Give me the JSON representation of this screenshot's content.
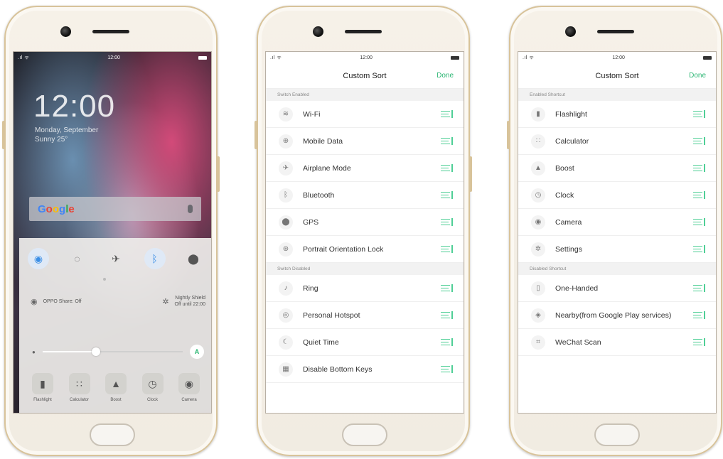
{
  "status": {
    "time": "12:00"
  },
  "lock_screen": {
    "clock": "12:00",
    "date_line": "Monday, September",
    "weather_line": "Sunny 25°",
    "search": {
      "logo": [
        "G",
        "o",
        "o",
        "g",
        "l",
        "e"
      ]
    },
    "quick_settings": {
      "toggles": [
        {
          "icon": "wifi-icon",
          "glyph": "◉",
          "on": true
        },
        {
          "icon": "mobile-data-icon",
          "glyph": "◌",
          "on": false
        },
        {
          "icon": "airplane-icon",
          "glyph": "✈",
          "on": false
        },
        {
          "icon": "bluetooth-icon",
          "glyph": "ᛒ",
          "on": true
        },
        {
          "icon": "location-icon",
          "glyph": "⬤",
          "on": false
        }
      ],
      "oppo_share": "OPPO Share: Off",
      "night_shield_1": "Nightly Shield",
      "night_shield_2": "Off until 22:00",
      "brightness": 0.38,
      "brightness_auto": "A",
      "shortcuts": [
        {
          "label": "Flashlight",
          "glyph": "▮",
          "icon": "flashlight-icon"
        },
        {
          "label": "Calculator",
          "glyph": "∷",
          "icon": "calculator-icon"
        },
        {
          "label": "Boost",
          "glyph": "▲",
          "icon": "boost-icon"
        },
        {
          "label": "Clock",
          "glyph": "◷",
          "icon": "clock-icon"
        },
        {
          "label": "Camera",
          "glyph": "◉",
          "icon": "camera-icon"
        }
      ]
    }
  },
  "sort_switch": {
    "title": "Custom Sort",
    "done": "Done",
    "enabled_header": "Switch Enabled",
    "enabled": [
      {
        "label": "Wi-Fi",
        "glyph": "≋",
        "icon": "wifi-icon"
      },
      {
        "label": "Mobile Data",
        "glyph": "⊕",
        "icon": "mobile-data-icon"
      },
      {
        "label": "Airplane Mode",
        "glyph": "✈",
        "icon": "airplane-icon"
      },
      {
        "label": "Bluetooth",
        "glyph": "ᛒ",
        "icon": "bluetooth-icon"
      },
      {
        "label": "GPS",
        "glyph": "⬤",
        "icon": "gps-icon"
      },
      {
        "label": "Portrait Orientation Lock",
        "glyph": "⊛",
        "icon": "orientation-lock-icon"
      }
    ],
    "disabled_header": "Switch Disabled",
    "disabled": [
      {
        "label": "Ring",
        "glyph": "♪",
        "icon": "ring-icon"
      },
      {
        "label": "Personal Hotspot",
        "glyph": "◎",
        "icon": "hotspot-icon"
      },
      {
        "label": "Quiet Time",
        "glyph": "☾",
        "icon": "moon-icon"
      },
      {
        "label": "Disable Bottom Keys",
        "glyph": "▦",
        "icon": "keys-icon"
      }
    ]
  },
  "sort_shortcut": {
    "title": "Custom Sort",
    "done": "Done",
    "enabled_header": "Enabled Shortcut",
    "enabled": [
      {
        "label": "Flashlight",
        "glyph": "▮",
        "icon": "flashlight-icon"
      },
      {
        "label": "Calculator",
        "glyph": "∷",
        "icon": "calculator-icon"
      },
      {
        "label": "Boost",
        "glyph": "▲",
        "icon": "boost-icon"
      },
      {
        "label": "Clock",
        "glyph": "◷",
        "icon": "clock-icon"
      },
      {
        "label": "Camera",
        "glyph": "◉",
        "icon": "camera-icon"
      },
      {
        "label": "Settings",
        "glyph": "✲",
        "icon": "settings-icon"
      }
    ],
    "disabled_header": "Disabled Shortcut",
    "disabled": [
      {
        "label": "One-Handed",
        "glyph": "▯",
        "icon": "one-handed-icon"
      },
      {
        "label": "Nearby(from Google Play services)",
        "glyph": "◈",
        "icon": "nearby-icon"
      },
      {
        "label": "WeChat Scan",
        "glyph": "⌗",
        "icon": "scan-icon"
      }
    ]
  },
  "colors": {
    "accent": "#2bb673",
    "drag": "#4fcf96",
    "toggle_on": "#3a8ee6"
  }
}
